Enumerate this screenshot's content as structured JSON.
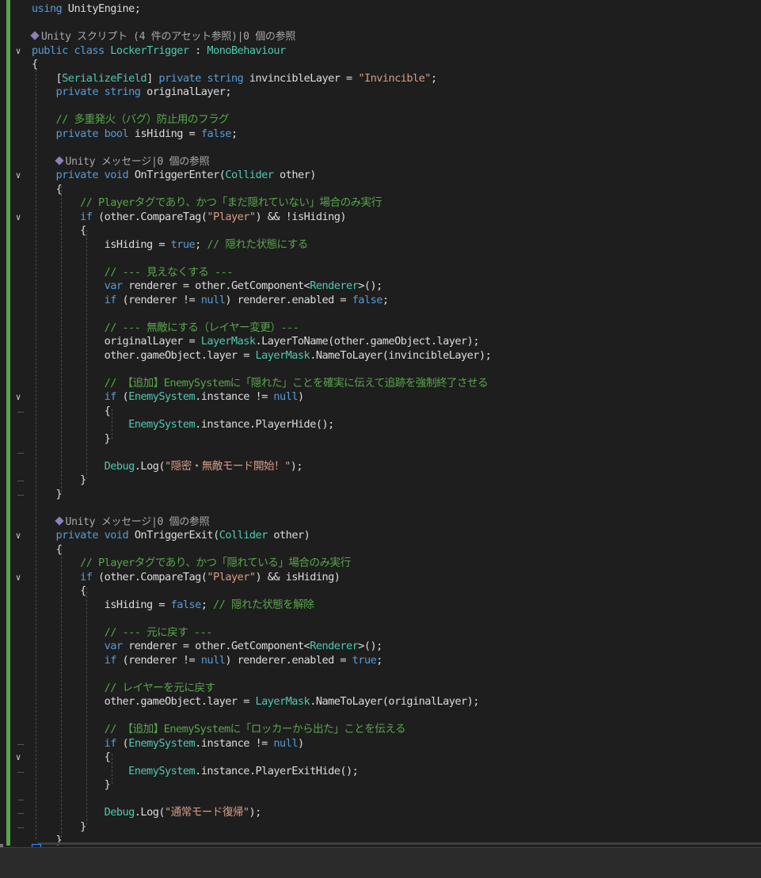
{
  "code_lines": [
    [
      {
        "t": "using",
        "c": "kw"
      },
      {
        "t": " UnityEngine;"
      }
    ],
    [],
    [
      {
        "t": "Unity スクリプト (4 件のアセット参照)|0 個の参照",
        "c": "cl",
        "icon": true
      }
    ],
    [
      {
        "t": "public",
        "c": "kw"
      },
      {
        "t": " "
      },
      {
        "t": "class",
        "c": "kw"
      },
      {
        "t": " "
      },
      {
        "t": "LockerTrigger",
        "c": "ty"
      },
      {
        "t": " : "
      },
      {
        "t": "MonoBehaviour",
        "c": "ty"
      }
    ],
    [
      {
        "t": "{"
      }
    ],
    [
      {
        "t": "    ["
      },
      {
        "t": "SerializeField",
        "c": "ty"
      },
      {
        "t": "] "
      },
      {
        "t": "private",
        "c": "kw"
      },
      {
        "t": " "
      },
      {
        "t": "string",
        "c": "kw"
      },
      {
        "t": " invincibleLayer = "
      },
      {
        "t": "\"Invincible\"",
        "c": "st"
      },
      {
        "t": ";"
      }
    ],
    [
      {
        "t": "    "
      },
      {
        "t": "private",
        "c": "kw"
      },
      {
        "t": " "
      },
      {
        "t": "string",
        "c": "kw"
      },
      {
        "t": " originalLayer;"
      }
    ],
    [],
    [
      {
        "t": "    "
      },
      {
        "t": "// 多重発火（バグ）防止用のフラグ",
        "c": "cm"
      }
    ],
    [
      {
        "t": "    "
      },
      {
        "t": "private",
        "c": "kw"
      },
      {
        "t": " "
      },
      {
        "t": "bool",
        "c": "kw"
      },
      {
        "t": " isHiding = "
      },
      {
        "t": "false",
        "c": "kw"
      },
      {
        "t": ";"
      }
    ],
    [],
    [
      {
        "t": "    "
      },
      {
        "t": "Unity メッセージ|0 個の参照",
        "c": "cl",
        "icon": true
      }
    ],
    [
      {
        "t": "    "
      },
      {
        "t": "private",
        "c": "kw"
      },
      {
        "t": " "
      },
      {
        "t": "void",
        "c": "kw"
      },
      {
        "t": " OnTriggerEnter("
      },
      {
        "t": "Collider",
        "c": "ty"
      },
      {
        "t": " other)"
      }
    ],
    [
      {
        "t": "    {"
      }
    ],
    [
      {
        "t": "        "
      },
      {
        "t": "// Playerタグであり、かつ「まだ隠れていない」場合のみ実行",
        "c": "cm"
      }
    ],
    [
      {
        "t": "        "
      },
      {
        "t": "if",
        "c": "kw"
      },
      {
        "t": " (other.CompareTag("
      },
      {
        "t": "\"Player\"",
        "c": "st"
      },
      {
        "t": ") && !isHiding)"
      }
    ],
    [
      {
        "t": "        {"
      }
    ],
    [
      {
        "t": "            isHiding = "
      },
      {
        "t": "true",
        "c": "kw"
      },
      {
        "t": "; "
      },
      {
        "t": "// 隠れた状態にする",
        "c": "cm"
      }
    ],
    [],
    [
      {
        "t": "            "
      },
      {
        "t": "// --- 見えなくする ---",
        "c": "cm"
      }
    ],
    [
      {
        "t": "            "
      },
      {
        "t": "var",
        "c": "kw"
      },
      {
        "t": " renderer = other.GetComponent<"
      },
      {
        "t": "Renderer",
        "c": "ty"
      },
      {
        "t": ">();"
      }
    ],
    [
      {
        "t": "            "
      },
      {
        "t": "if",
        "c": "kw"
      },
      {
        "t": " (renderer != "
      },
      {
        "t": "null",
        "c": "kw"
      },
      {
        "t": ") renderer.enabled = "
      },
      {
        "t": "false",
        "c": "kw"
      },
      {
        "t": ";"
      }
    ],
    [],
    [
      {
        "t": "            "
      },
      {
        "t": "// --- 無敵にする（レイヤー変更）---",
        "c": "cm"
      }
    ],
    [
      {
        "t": "            originalLayer = "
      },
      {
        "t": "LayerMask",
        "c": "ty"
      },
      {
        "t": ".LayerToName(other.gameObject.layer);"
      }
    ],
    [
      {
        "t": "            other.gameObject.layer = "
      },
      {
        "t": "LayerMask",
        "c": "ty"
      },
      {
        "t": ".NameToLayer(invincibleLayer);"
      }
    ],
    [],
    [
      {
        "t": "            "
      },
      {
        "t": "// 【追加】EnemySystemに「隠れた」ことを確実に伝えて追跡を強制終了させる",
        "c": "cm"
      }
    ],
    [
      {
        "t": "            "
      },
      {
        "t": "if",
        "c": "kw"
      },
      {
        "t": " ("
      },
      {
        "t": "EnemySystem",
        "c": "ty"
      },
      {
        "t": ".instance != "
      },
      {
        "t": "null",
        "c": "kw"
      },
      {
        "t": ")"
      }
    ],
    [
      {
        "t": "            {"
      }
    ],
    [
      {
        "t": "                "
      },
      {
        "t": "EnemySystem",
        "c": "ty"
      },
      {
        "t": ".instance.PlayerHide();"
      }
    ],
    [
      {
        "t": "            }"
      }
    ],
    [],
    [
      {
        "t": "            "
      },
      {
        "t": "Debug",
        "c": "ty"
      },
      {
        "t": ".Log("
      },
      {
        "t": "\"隠密・無敵モード開始！\"",
        "c": "st"
      },
      {
        "t": ");"
      }
    ],
    [
      {
        "t": "        }"
      }
    ],
    [
      {
        "t": "    }"
      }
    ],
    [],
    [
      {
        "t": "    "
      },
      {
        "t": "Unity メッセージ|0 個の参照",
        "c": "cl",
        "icon": true
      }
    ],
    [
      {
        "t": "    "
      },
      {
        "t": "private",
        "c": "kw"
      },
      {
        "t": " "
      },
      {
        "t": "void",
        "c": "kw"
      },
      {
        "t": " OnTriggerExit("
      },
      {
        "t": "Collider",
        "c": "ty"
      },
      {
        "t": " other)"
      }
    ],
    [
      {
        "t": "    {"
      }
    ],
    [
      {
        "t": "        "
      },
      {
        "t": "// Playerタグであり、かつ「隠れている」場合のみ実行",
        "c": "cm"
      }
    ],
    [
      {
        "t": "        "
      },
      {
        "t": "if",
        "c": "kw"
      },
      {
        "t": " (other.CompareTag("
      },
      {
        "t": "\"Player\"",
        "c": "st"
      },
      {
        "t": ") && isHiding)"
      }
    ],
    [
      {
        "t": "        {"
      }
    ],
    [
      {
        "t": "            isHiding = "
      },
      {
        "t": "false",
        "c": "kw"
      },
      {
        "t": "; "
      },
      {
        "t": "// 隠れた状態を解除",
        "c": "cm"
      }
    ],
    [],
    [
      {
        "t": "            "
      },
      {
        "t": "// --- 元に戻す ---",
        "c": "cm"
      }
    ],
    [
      {
        "t": "            "
      },
      {
        "t": "var",
        "c": "kw"
      },
      {
        "t": " renderer = other.GetComponent<"
      },
      {
        "t": "Renderer",
        "c": "ty"
      },
      {
        "t": ">();"
      }
    ],
    [
      {
        "t": "            "
      },
      {
        "t": "if",
        "c": "kw"
      },
      {
        "t": " (renderer != "
      },
      {
        "t": "null",
        "c": "kw"
      },
      {
        "t": ") renderer.enabled = "
      },
      {
        "t": "true",
        "c": "kw"
      },
      {
        "t": ";"
      }
    ],
    [],
    [
      {
        "t": "            "
      },
      {
        "t": "// レイヤーを元に戻す",
        "c": "cm"
      }
    ],
    [
      {
        "t": "            other.gameObject.layer = "
      },
      {
        "t": "LayerMask",
        "c": "ty"
      },
      {
        "t": ".NameToLayer(originalLayer);"
      }
    ],
    [],
    [
      {
        "t": "            "
      },
      {
        "t": "// 【追加】EnemySystemに「ロッカーから出た」ことを伝える",
        "c": "cm"
      }
    ],
    [
      {
        "t": "            "
      },
      {
        "t": "if",
        "c": "kw"
      },
      {
        "t": " ("
      },
      {
        "t": "EnemySystem",
        "c": "ty"
      },
      {
        "t": ".instance != "
      },
      {
        "t": "null",
        "c": "kw"
      },
      {
        "t": ")"
      }
    ],
    [
      {
        "t": "            {"
      }
    ],
    [
      {
        "t": "                "
      },
      {
        "t": "EnemySystem",
        "c": "ty"
      },
      {
        "t": ".instance.PlayerExitHide();"
      }
    ],
    [
      {
        "t": "            }"
      }
    ],
    [],
    [
      {
        "t": "            "
      },
      {
        "t": "Debug",
        "c": "ty"
      },
      {
        "t": ".Log("
      },
      {
        "t": "\"通常モード復帰\"",
        "c": "st"
      },
      {
        "t": ");"
      }
    ],
    [
      {
        "t": "        }"
      }
    ],
    [
      {
        "t": "    }"
      }
    ],
    [
      {
        "t": "}"
      }
    ]
  ],
  "fold_lines": [
    3,
    12,
    15,
    28,
    38,
    41,
    54
  ],
  "fold_ends": [
    29,
    32,
    34,
    35,
    53,
    55,
    57,
    58,
    59
  ],
  "colors": {
    "background": "#1e1e1e",
    "keyword": "#569cd6",
    "type": "#4ec9b0",
    "string": "#d69d85",
    "comment": "#57a64a",
    "codelens": "#a9a9a9",
    "change_bar": "#57a64a"
  }
}
